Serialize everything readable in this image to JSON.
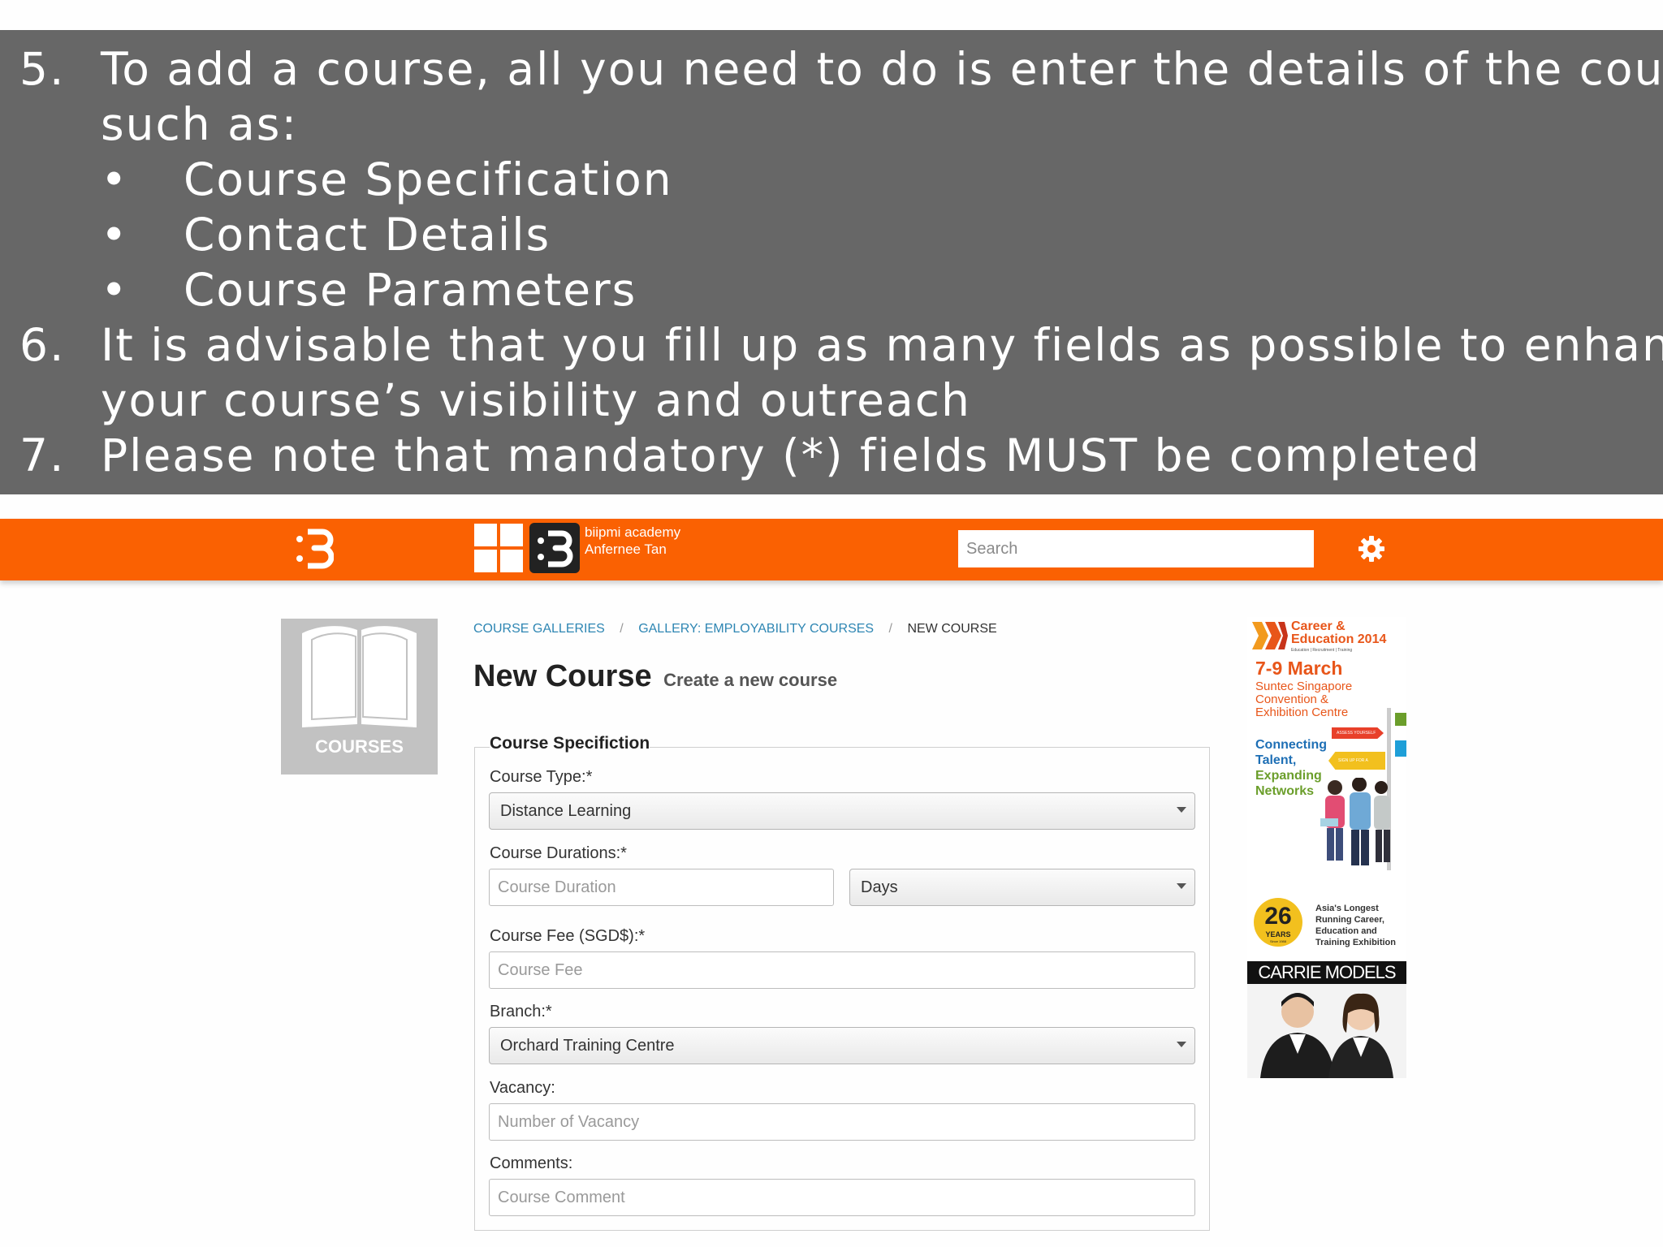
{
  "instructions": [
    {
      "num": "5.",
      "text": "To add a course, all you need to do is enter the details of the course",
      "cont": "such as:"
    },
    {
      "bullets": [
        "Course Specification",
        "Contact Details",
        "Course Parameters"
      ]
    },
    {
      "num": "6.",
      "text": "It is advisable that you fill up as many fields as possible to enhance",
      "cont": "your course’s visibility and outreach"
    },
    {
      "num": "7.",
      "text": "Please note that mandatory (*) fields MUST be completed"
    }
  ],
  "bullet_glyph": "•",
  "topbar": {
    "org_name": "biipmi academy",
    "user_name": "Anfernee Tan",
    "search_placeholder": "Search",
    "icons": [
      "biipmi-logo-icon",
      "grid-icon",
      "gear-icon"
    ],
    "color": "#fa6102"
  },
  "tile": {
    "label": "COURSES",
    "icon": "book-icon"
  },
  "breadcrumb": {
    "items": [
      "COURSE GALLERIES",
      "GALLERY: EMPLOYABILITY COURSES"
    ],
    "current": "NEW COURSE",
    "separator": "/"
  },
  "page": {
    "title": "New Course",
    "subtitle": "Create a new course"
  },
  "form": {
    "legend": "Course Specifiction",
    "course_type": {
      "label": "Course Type:*",
      "value": "Distance Learning"
    },
    "course_durations": {
      "label": "Course Durations:*",
      "placeholder": "Course Duration",
      "unit": "Days"
    },
    "course_fee": {
      "label": "Course Fee (SGD$):*",
      "placeholder": "Course Fee"
    },
    "branch": {
      "label": "Branch:*",
      "value": "Orchard Training Centre"
    },
    "vacancy": {
      "label": "Vacancy:",
      "placeholder": "Number of Vacancy"
    },
    "comments": {
      "label": "Comments:",
      "placeholder": "Course Comment"
    }
  },
  "ad": {
    "event_line1": "Career &",
    "event_line2": "Education 2014",
    "event_tagline": "Education | Recruitment | Training",
    "dates": "7-9 March",
    "venue": [
      "Suntec Singapore",
      "Convention &",
      "Exhibition Centre"
    ],
    "slogan": [
      "Connecting",
      "Talent,",
      "Expanding",
      "Networks"
    ],
    "sign1": "ASSESS YOURSELF",
    "sign2": "SIGN UP FOR A CAREER",
    "years_num": "26",
    "years_label": "YEARS",
    "years_since": "Since 1988",
    "claim": [
      "Asia's Longest",
      "Running Career,",
      "Education and",
      "Training Exhibition"
    ],
    "sponsor": "CARRIE MODELS",
    "colors": {
      "orange": "#e8561a",
      "green": "#6b9e2b",
      "blue": "#1e6fb5"
    }
  }
}
